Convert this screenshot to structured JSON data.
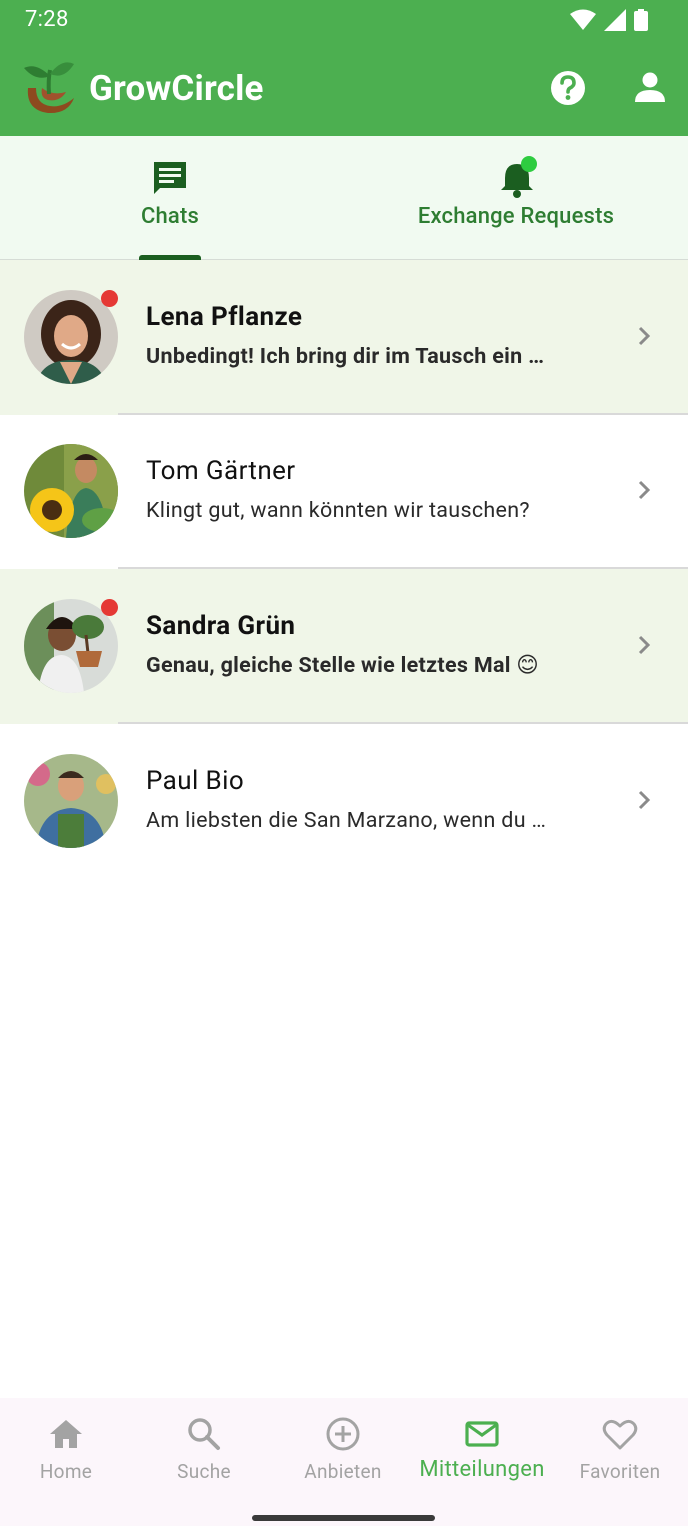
{
  "status_bar": {
    "time": "7:28"
  },
  "app_bar": {
    "title": "GrowCircle",
    "background": "#4caf50"
  },
  "tabs": [
    {
      "label": "Chats",
      "icon": "chat-icon",
      "active": true
    },
    {
      "label": "Exchange Requests",
      "icon": "bell-icon",
      "has_badge": true
    }
  ],
  "chats": [
    {
      "name": "Lena Pflanze",
      "message": "Unbedingt! Ich bring dir im Tausch ein …",
      "unread": true,
      "avatar": "woman-curly-hair-avatar"
    },
    {
      "name": "Tom Gärtner",
      "message": "Klingt gut, wann könnten wir tauschen?",
      "unread": false,
      "avatar": "man-sunflower-avatar"
    },
    {
      "name": "Sandra Grün",
      "message": "Genau, gleiche Stelle wie letztes Mal 😊",
      "unread": true,
      "avatar": "woman-bonsai-avatar"
    },
    {
      "name": "Paul Bio",
      "message": "Am liebsten die San Marzano, wenn du …",
      "unread": false,
      "avatar": "man-apron-avatar"
    }
  ],
  "bottom_nav": [
    {
      "label": "Home",
      "icon": "home-icon",
      "active": false
    },
    {
      "label": "Suche",
      "icon": "search-icon",
      "active": false
    },
    {
      "label": "Anbieten",
      "icon": "add-circle-icon",
      "active": false
    },
    {
      "label": "Mitteilungen",
      "icon": "mail-icon",
      "active": true
    },
    {
      "label": "Favoriten",
      "icon": "heart-icon",
      "active": false
    }
  ],
  "colors": {
    "primary": "#4caf50",
    "primary_dark": "#2e7d32",
    "unread_bg": "#f0f6e8",
    "unread_dot": "#e53935",
    "tab_bg": "#f1faf1",
    "nav_bg": "#fcf6fb",
    "nav_inactive": "#a3a3a3"
  }
}
